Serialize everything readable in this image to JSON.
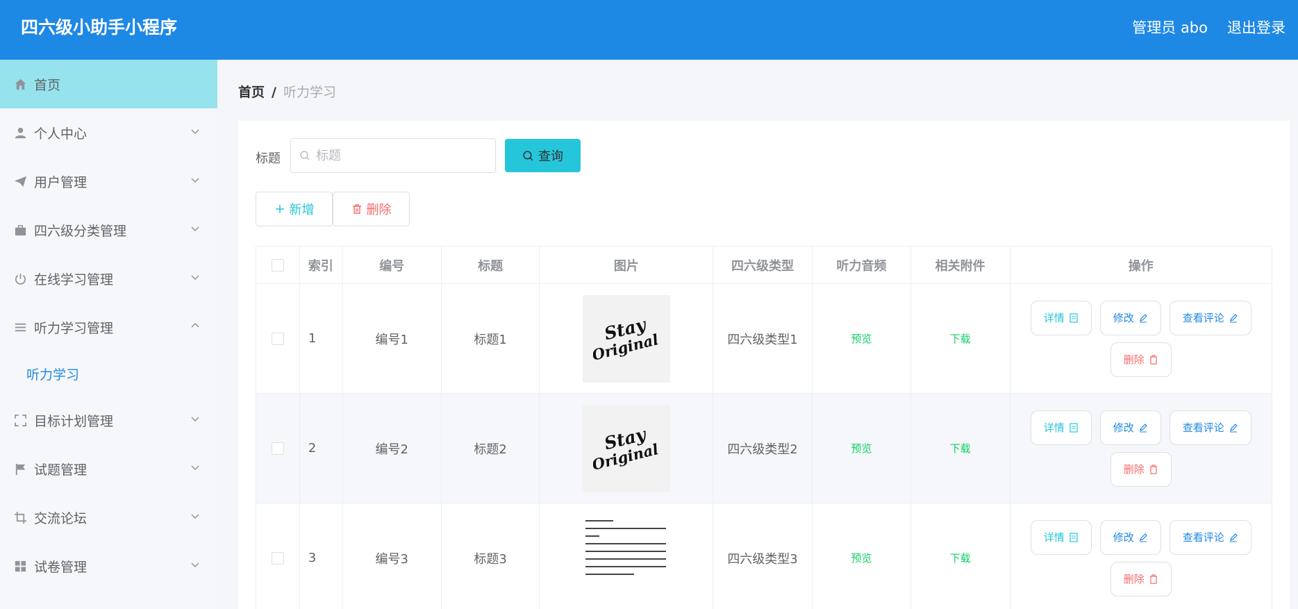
{
  "header": {
    "title": "四六级小助手小程序",
    "admin": "管理员 abo",
    "logout": "退出登录"
  },
  "sidebar": {
    "items": [
      {
        "label": "首页",
        "icon": "home-icon"
      },
      {
        "label": "个人中心",
        "icon": "user-icon"
      },
      {
        "label": "用户管理",
        "icon": "send-icon"
      },
      {
        "label": "四六级分类管理",
        "icon": "briefcase-icon"
      },
      {
        "label": "在线学习管理",
        "icon": "power-icon"
      },
      {
        "label": "听力学习管理",
        "icon": "list-icon"
      },
      {
        "label": "目标计划管理",
        "icon": "fullscreen-icon"
      },
      {
        "label": "试题管理",
        "icon": "flag-icon"
      },
      {
        "label": "交流论坛",
        "icon": "crop-icon"
      },
      {
        "label": "试卷管理",
        "icon": "grid-icon"
      }
    ],
    "sub_item": "听力学习"
  },
  "breadcrumb": {
    "home": "首页",
    "separator": "/",
    "current": "听力学习"
  },
  "search": {
    "label": "标题",
    "placeholder": "标题",
    "button": "查询"
  },
  "actions": {
    "add": "新增",
    "delete": "删除"
  },
  "table": {
    "headers": [
      "索引",
      "编号",
      "标题",
      "图片",
      "四六级类型",
      "听力音频",
      "相关附件",
      "操作"
    ],
    "rows": [
      {
        "index": "1",
        "code": "编号1",
        "title": "标题1",
        "type": "四六级类型1",
        "audio": "预览",
        "attach": "下载",
        "image": "stay-original-logo"
      },
      {
        "index": "2",
        "code": "编号2",
        "title": "标题2",
        "type": "四六级类型2",
        "audio": "预览",
        "attach": "下载",
        "image": "stay-original-logo"
      },
      {
        "index": "3",
        "code": "编号3",
        "title": "标题3",
        "type": "四六级类型3",
        "audio": "预览",
        "attach": "下载",
        "image": "text-document"
      }
    ],
    "ops": {
      "detail": "详情",
      "edit": "修改",
      "comment": "查看评论",
      "delete": "删除"
    }
  },
  "colors": {
    "header": "#1e88e5",
    "active_menu": "#96e3ee",
    "accent": "#26c6da",
    "danger": "#f56c6c",
    "success": "#13ce66"
  }
}
